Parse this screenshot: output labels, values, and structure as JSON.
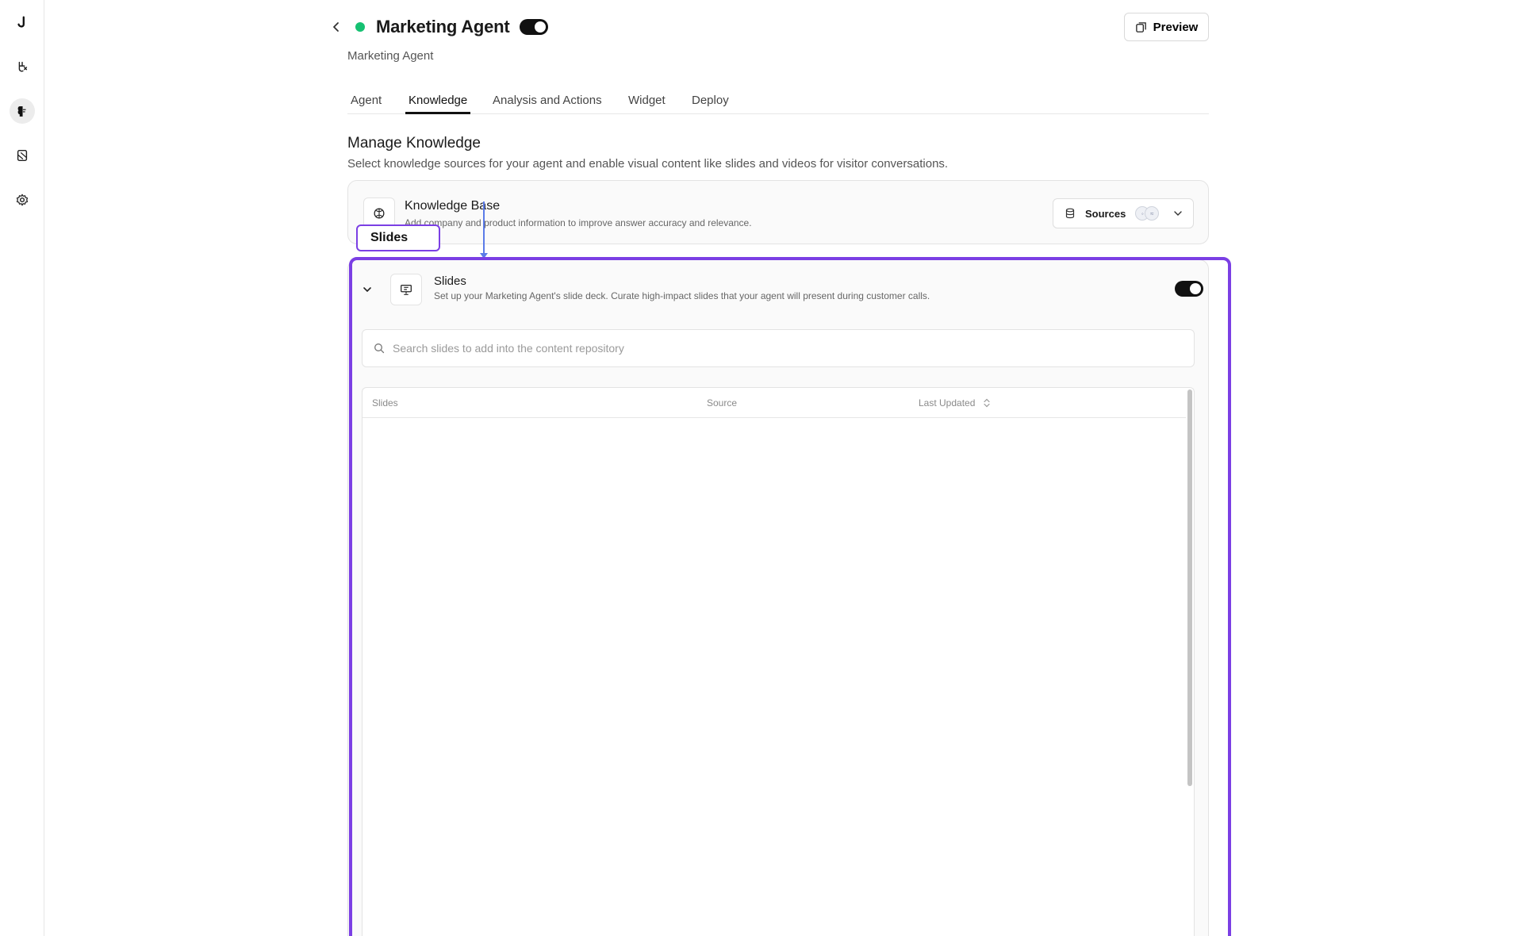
{
  "rail": {
    "items": [
      {
        "icon": "logo-icon"
      },
      {
        "icon": "agent-icon"
      },
      {
        "icon": "brain-icon"
      },
      {
        "icon": "document-icon"
      },
      {
        "icon": "gear-icon"
      }
    ]
  },
  "header": {
    "title": "Marketing Agent",
    "subtitle": "Marketing Agent",
    "preview_label": "Preview",
    "status_color": "#16c172"
  },
  "tabs": [
    {
      "label": "Agent"
    },
    {
      "label": "Knowledge",
      "active": true
    },
    {
      "label": "Analysis and Actions"
    },
    {
      "label": "Widget"
    },
    {
      "label": "Deploy"
    }
  ],
  "section": {
    "title": "Manage Knowledge",
    "description": "Select knowledge sources for your agent and enable visual content like slides and videos for visitor conversations."
  },
  "knowledge_base": {
    "title": "Knowledge Base",
    "description": "Add company and product information to improve answer accuracy and relevance.",
    "sources_label": "Sources"
  },
  "slides": {
    "title": "Slides",
    "description": "Set up your Marketing Agent's slide deck. Curate high-impact slides that your agent will present during customer calls.",
    "enabled": true,
    "search_placeholder": "Search slides to add into the content repository",
    "columns": [
      "Slides",
      "Source",
      "Last Updated"
    ]
  },
  "annotation": {
    "callout_label": "Slides",
    "highlight_color": "#7b3fe4"
  }
}
